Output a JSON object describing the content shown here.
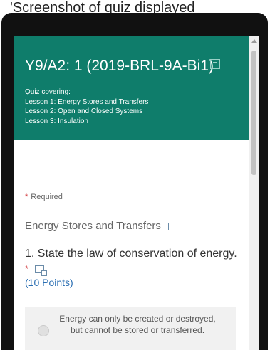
{
  "caption": "'Screenshot of quiz displayed",
  "header": {
    "title": "Y9/A2: 1 (2019-BRL-9A-Bi1)",
    "quiz_covering": "Quiz covering:",
    "lessons": [
      "Lesson 1: Energy Stores and Transfers",
      "Lesson 2: Open and Closed Systems",
      "Lesson 3: Insulation"
    ]
  },
  "required_note": "Required",
  "required_marker": "*",
  "section": {
    "title": "Energy Stores and Transfers"
  },
  "question": {
    "text": "1. State the law of conservation of energy.",
    "required_marker": "*",
    "points": "(10 Points)"
  },
  "options": [
    {
      "text": "Energy can only be created or destroyed, but cannot be stored or transferred."
    }
  ],
  "colors": {
    "header": "#0f7d6b",
    "required": "#d13438",
    "link": "#2b6fb3"
  },
  "icons": [
    "immersive-reader-icon",
    "media-icon"
  ]
}
